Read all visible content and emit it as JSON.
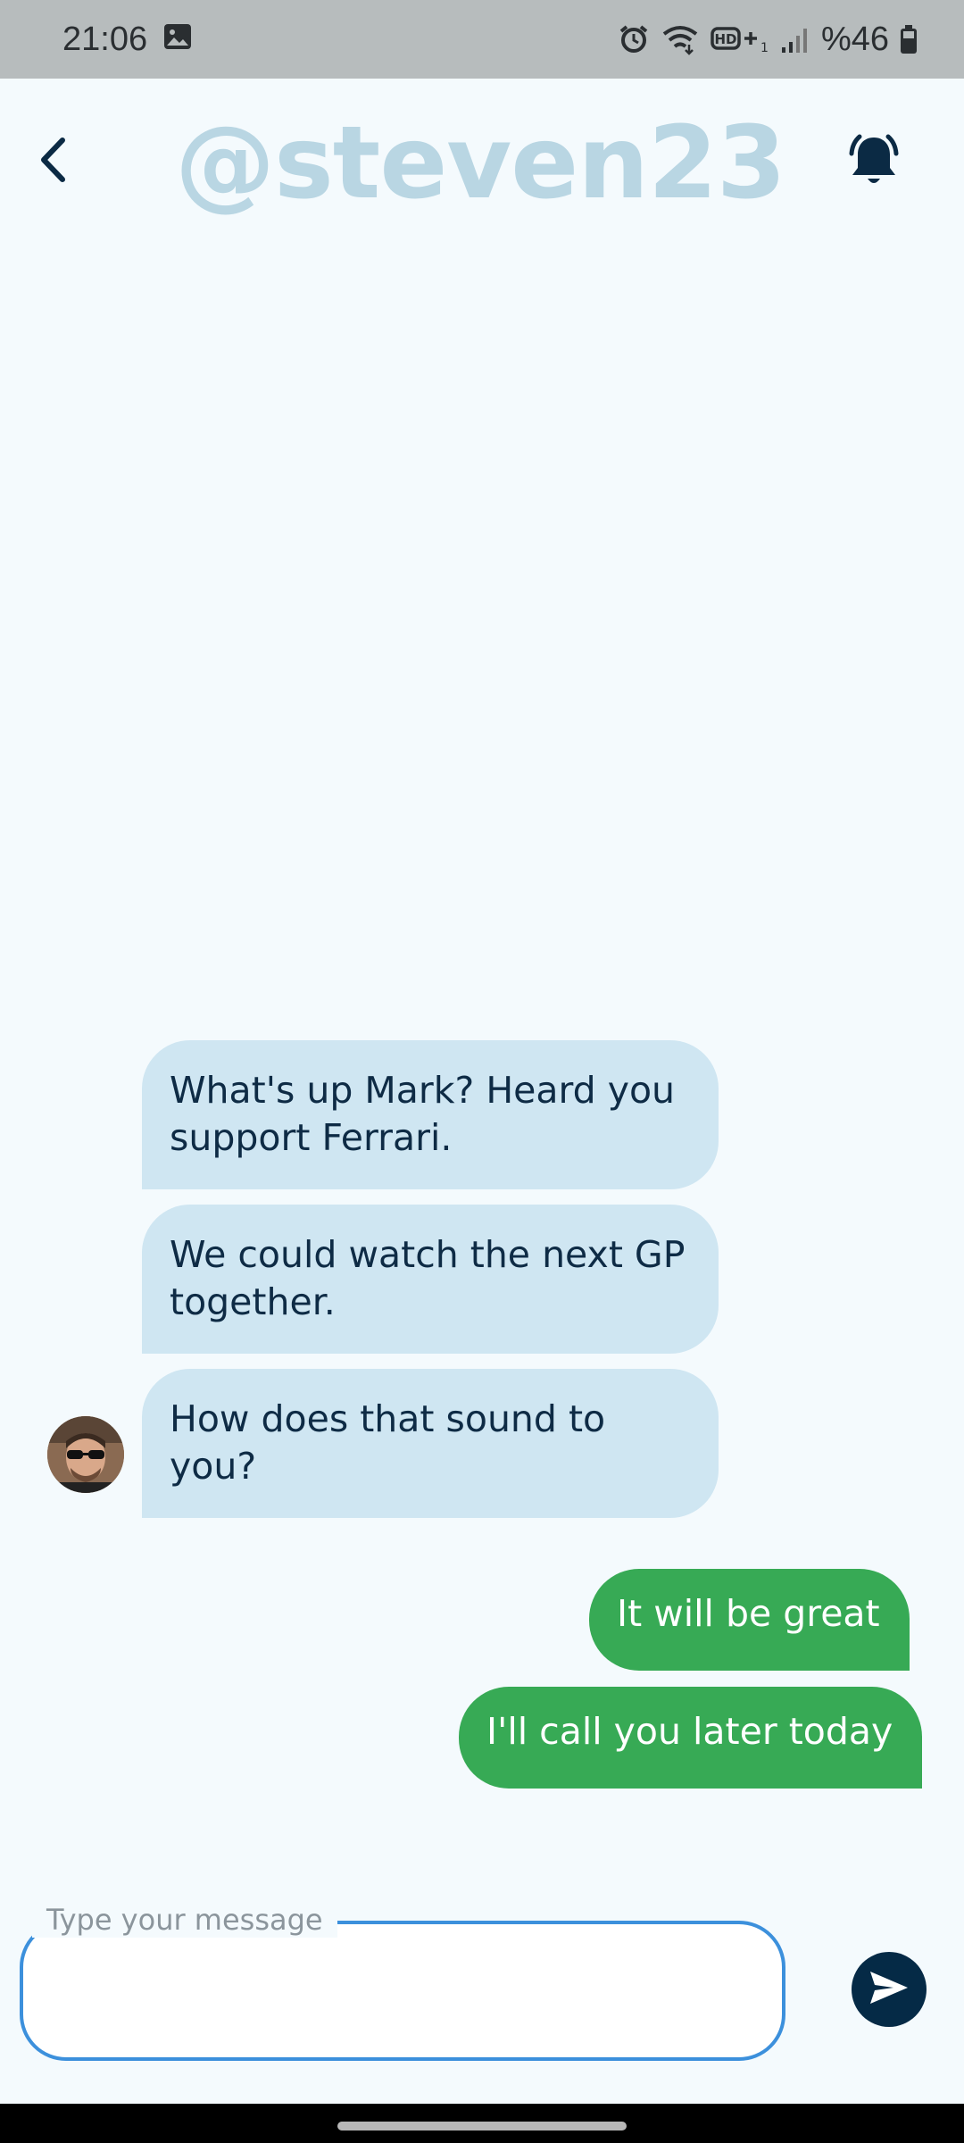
{
  "status_bar": {
    "time": "21:06",
    "battery_text": "%46",
    "icons": [
      "image-icon",
      "alarm-icon",
      "wifi-icon",
      "hd-plus-icon",
      "signal-icon",
      "battery-icon"
    ]
  },
  "header": {
    "title": "@steven23",
    "back_icon": "chevron-left-icon",
    "bell_icon": "bell-ringing-icon"
  },
  "messages": [
    {
      "direction": "in",
      "text": "What's up Mark? Heard you support Ferrari."
    },
    {
      "direction": "in",
      "text": "We could watch the next GP together."
    },
    {
      "direction": "in",
      "text": "How does that sound to you?"
    },
    {
      "direction": "out",
      "text": "It will be great"
    },
    {
      "direction": "out",
      "text": "I'll call you later today"
    }
  ],
  "composer": {
    "label": "Type your message",
    "value": "",
    "send_icon": "send-icon"
  },
  "colors": {
    "background": "#f4fafd",
    "incoming_bubble": "#cfe6f2",
    "outgoing_bubble": "#37aa55",
    "title": "#b9d6e3",
    "accent_border": "#3c90dc",
    "send_button": "#052a46"
  }
}
